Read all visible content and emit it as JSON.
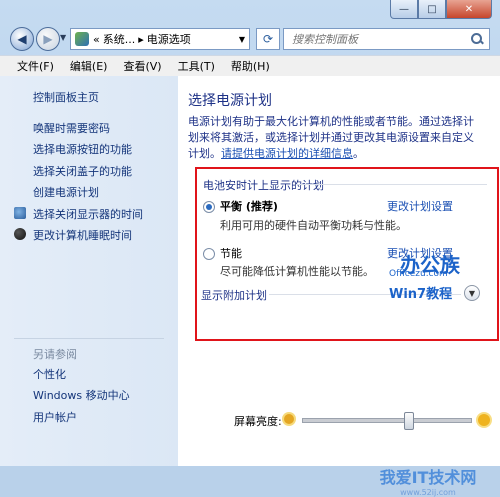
{
  "window": {
    "caption": {
      "minimize": "—",
      "maximize": "□",
      "close": "✕"
    }
  },
  "nav": {
    "breadcrumb": [
      "«",
      "系统...",
      "▸",
      "电源选项"
    ],
    "search_placeholder": "搜索控制面板"
  },
  "menu": [
    "文件(F)",
    "编辑(E)",
    "查看(V)",
    "工具(T)",
    "帮助(H)"
  ],
  "sidebar": {
    "home": "控制面板主页",
    "items": [
      {
        "label": "唤醒时需要密码"
      },
      {
        "label": "选择电源按钮的功能"
      },
      {
        "label": "选择关闭盖子的功能"
      },
      {
        "label": "创建电源计划"
      },
      {
        "label": "选择关闭显示器的时间",
        "icon": "monitor-icon"
      },
      {
        "label": "更改计算机睡眠时间",
        "icon": "moon-icon"
      }
    ],
    "see_also": "另请参阅",
    "see_also_items": [
      "个性化",
      "Windows 移动中心",
      "用户帐户"
    ]
  },
  "main": {
    "title": "选择电源计划",
    "desc_line1": "电源计划有助于最大化计算机的性能或者节能。通过选择计",
    "desc_line2": "划来将其激活，或选择计划并通过更改其电源设置来自定义",
    "desc_line3_prefix": "计划。",
    "desc_link": "请提供电源计划的详细信息",
    "desc_line3_suffix": "。",
    "group_title": "电池安时计上显示的计划",
    "plans": [
      {
        "name": "平衡 (推荐)",
        "desc": "利用可用的硬件自动平衡功耗与性能。",
        "selected": true,
        "change": "更改计划设置"
      },
      {
        "name": "节能",
        "desc": "尽可能降低计算机性能以节能。",
        "selected": false,
        "change": "更改计划设置"
      }
    ],
    "more_plans": "显示附加计划",
    "brightness_label": "屏幕亮度:",
    "brightness_level": 0.6
  },
  "watermarks": {
    "logo_cn": "办公族",
    "logo_url": "Officezu.com",
    "logo_sub": "Win7教程",
    "site": "我爱IT技术网",
    "site_url": "www.52ij.com"
  }
}
